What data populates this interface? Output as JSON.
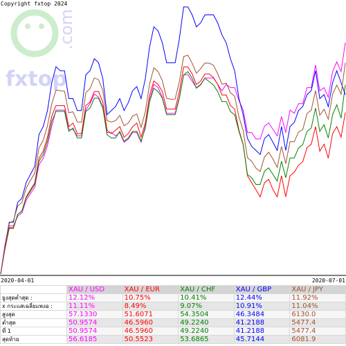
{
  "copyright": "Copyright fxtop 2024",
  "watermark": {
    "logo": "fxtop",
    "domain": ".com"
  },
  "chart_data": {
    "type": "line",
    "xlabel": "",
    "ylabel": "",
    "x_start_label": "2020-04-01",
    "x_end_label": "2020-07-01",
    "grid": false,
    "legend": "none",
    "series": [
      {
        "name": "XAU / USD",
        "color": "#ff00ff",
        "values": [
          51.1,
          52.0,
          52.6,
          52.6,
          52.9,
          53.0,
          53.4,
          53.6,
          53.8,
          54.5,
          54.7,
          55.1,
          55.7,
          56.2,
          56.2,
          56.2,
          55.6,
          55.6,
          55.4,
          55.4,
          56.2,
          56.4,
          56.7,
          56.6,
          56.3,
          55.5,
          55.5,
          55.4,
          55.5,
          55.2,
          55.3,
          55.5,
          55.5,
          55.2,
          55.7,
          56.5,
          57.0,
          56.9,
          56.6,
          56.1,
          56.1,
          56.1,
          56.6,
          57.3,
          57.3,
          57.1,
          56.9,
          57.0,
          57.2,
          57.2,
          57.2,
          57.0,
          56.8,
          57.0,
          56.9,
          56.9,
          56.5,
          56.2,
          55.5,
          55.5,
          55.3,
          55.3,
          55.7,
          55.8,
          55.6,
          55.4,
          56.0,
          55.5,
          56.2,
          56.1,
          56.4,
          56.4,
          56.9,
          56.9,
          57.6,
          56.8,
          56.9,
          56.6,
          57.4,
          57.7,
          57.4,
          58.3
        ]
      },
      {
        "name": "XAU / EUR",
        "color": "#ff0000",
        "values": [
          46.8,
          47.5,
          48.1,
          48.1,
          48.5,
          48.6,
          49.0,
          49.2,
          49.4,
          50.1,
          50.3,
          50.7,
          51.3,
          51.6,
          51.6,
          51.6,
          51.0,
          51.1,
          50.8,
          50.8,
          51.6,
          51.7,
          52.0,
          52.0,
          51.7,
          50.9,
          50.8,
          50.9,
          51.0,
          50.7,
          50.8,
          51.0,
          51.1,
          50.7,
          51.1,
          51.9,
          52.3,
          52.2,
          52.0,
          51.5,
          51.5,
          51.5,
          52.0,
          52.7,
          52.7,
          52.5,
          52.2,
          52.3,
          52.5,
          52.5,
          52.4,
          52.2,
          51.9,
          51.9,
          51.6,
          51.5,
          50.9,
          50.5,
          49.6,
          49.4,
          49.2,
          49.0,
          49.4,
          49.5,
          49.2,
          49.0,
          49.6,
          49.0,
          49.6,
          49.7,
          49.9,
          50.0,
          50.4,
          50.5,
          51.0,
          50.3,
          50.5,
          50.1,
          50.8,
          51.0,
          50.7,
          51.4
        ]
      },
      {
        "name": "XAU / CHF",
        "color": "#008000",
        "values": [
          49.5,
          50.3,
          50.9,
          50.9,
          51.3,
          51.4,
          51.8,
          52.0,
          52.2,
          52.9,
          53.1,
          53.5,
          54.1,
          54.4,
          54.4,
          54.4,
          53.8,
          53.9,
          53.6,
          53.6,
          54.4,
          54.5,
          54.8,
          54.8,
          54.5,
          53.7,
          53.6,
          53.6,
          53.8,
          53.5,
          53.6,
          53.8,
          53.8,
          53.5,
          53.9,
          54.7,
          55.1,
          55.0,
          54.8,
          54.3,
          54.3,
          54.3,
          54.8,
          55.5,
          55.6,
          55.4,
          55.1,
          55.2,
          55.4,
          55.3,
          55.2,
          55.0,
          54.7,
          54.7,
          54.4,
          54.3,
          53.8,
          53.4,
          52.5,
          52.4,
          52.2,
          52.2,
          52.6,
          52.7,
          52.5,
          52.3,
          52.9,
          52.4,
          53.0,
          53.0,
          53.3,
          53.4,
          53.8,
          53.9,
          54.5,
          53.8,
          54.0,
          53.6,
          54.3,
          54.6,
          54.2,
          55.2
        ]
      },
      {
        "name": "XAU / GBP",
        "color": "#0000ff",
        "values": [
          41.2,
          41.9,
          42.5,
          42.5,
          43.0,
          43.1,
          43.5,
          43.7,
          43.9,
          44.7,
          44.9,
          45.3,
          46.0,
          46.4,
          46.3,
          46.3,
          45.6,
          45.6,
          45.3,
          45.3,
          46.2,
          46.3,
          46.6,
          46.5,
          46.1,
          45.2,
          45.3,
          45.4,
          45.6,
          45.3,
          45.5,
          45.8,
          45.9,
          45.6,
          46.1,
          46.9,
          47.4,
          47.3,
          47.0,
          46.5,
          46.5,
          46.5,
          47.1,
          47.9,
          47.9,
          47.7,
          47.4,
          47.5,
          47.7,
          47.7,
          47.7,
          47.5,
          47.2,
          47.0,
          46.6,
          46.3,
          45.6,
          45.2,
          44.6,
          44.4,
          44.3,
          44.2,
          44.6,
          44.7,
          44.5,
          44.3,
          44.9,
          44.3,
          44.9,
          45.0,
          45.3,
          45.4,
          45.7,
          45.8,
          46.3,
          45.6,
          45.7,
          45.4,
          46.0,
          46.3,
          46.0,
          45.7
        ]
      },
      {
        "name": "XAU / JPY",
        "color": "#a0522d",
        "values": [
          5477.4,
          5565.3,
          5646.6,
          5655.0,
          5704.7,
          5716.1,
          5763.6,
          5790.1,
          5813.2,
          5897.9,
          5924.2,
          5972.0,
          6045.1,
          6090.6,
          6088.8,
          6087.0,
          6015.6,
          6018.2,
          5984.7,
          5984.1,
          6081.2,
          6096.0,
          6131.3,
          6125.3,
          6089.8,
          5989.3,
          5984.2,
          5989.1,
          6006.2,
          5971.5,
          5981.0,
          6003.9,
          6010.9,
          5966.3,
          6018.6,
          6111.5,
          6165.1,
          6152.1,
          6122.1,
          6063.4,
          6060.4,
          6060.8,
          6119.5,
          6202.6,
          6206.8,
          6180.5,
          6147.3,
          6162.3,
          6181.3,
          6180.6,
          6173.8,
          6145.5,
          6110.6,
          6114.1,
          6081.6,
          6070.4,
          6001.1,
          5956.3,
          5865.3,
          5853.2,
          5830.5,
          5819.2,
          5867.9,
          5883.6,
          5860.4,
          5833.1,
          5903.0,
          5845.3,
          5919.1,
          5918.3,
          5951.1,
          5958.9,
          6012.8,
          6023.9,
          6089.1,
          6007.1,
          6026.7,
          5993.7,
          6077.3,
          6107.5,
          6077.4,
          6182.0
        ]
      }
    ]
  },
  "table": {
    "headers": [
      "XAU / USD",
      "XAU / EUR",
      "XAU / CHF",
      "XAU / GBP",
      "XAU / JPY"
    ],
    "rows": [
      {
        "label": "ยูงสุดต่ำสุด :",
        "values": [
          "12.12%",
          "10.75%",
          "10.41%",
          "12.44%",
          "11.92%"
        ]
      },
      {
        "label": "x กระแสเฉลี่ยแพงอ :",
        "values": [
          "11.11%",
          "8.49%",
          "9.07%",
          "10.91%",
          "11.04%"
        ]
      },
      {
        "label": "สูงสุด",
        "values": [
          "57.1330",
          "51.6071",
          "54.3504",
          "46.3484",
          "6130.0"
        ]
      },
      {
        "label": "ต่ำสุด",
        "values": [
          "50.9574",
          "46.5960",
          "49.2240",
          "41.2188",
          "5477.4"
        ]
      },
      {
        "label": "ที่ 1",
        "values": [
          "50.9574",
          "46.5960",
          "49.2240",
          "41.2188",
          "5477.4"
        ]
      },
      {
        "label": "สุดท้าย",
        "values": [
          "56.6185",
          "50.5523",
          "53.6865",
          "45.7144",
          "6081.9"
        ]
      }
    ]
  }
}
